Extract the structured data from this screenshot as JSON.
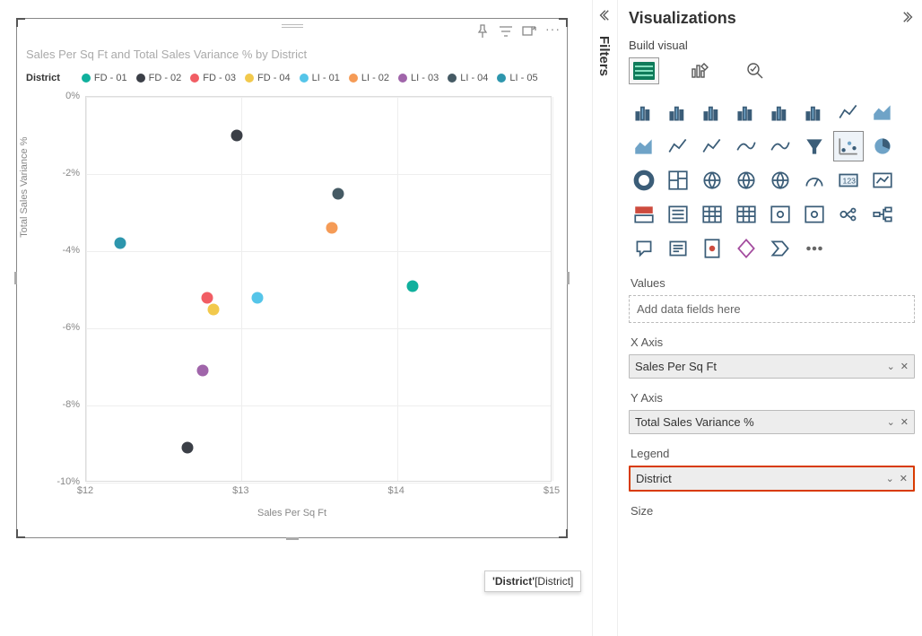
{
  "chart": {
    "title": "Sales Per Sq Ft and Total Sales Variance % by District",
    "legend_title": "District",
    "xlabel": "Sales Per Sq Ft",
    "ylabel": "Total Sales Variance %",
    "toolbar": {
      "pin": "Pin",
      "filters": "Filters",
      "focus": "Focus mode",
      "more": "More"
    }
  },
  "chart_data": {
    "type": "scatter",
    "xlabel": "Sales Per Sq Ft",
    "ylabel": "Total Sales Variance %",
    "xlim": [
      12,
      15
    ],
    "ylim": [
      -10,
      0
    ],
    "x_ticks": [
      "$12",
      "$13",
      "$14",
      "$15"
    ],
    "y_ticks": [
      "0%",
      "-2%",
      "-4%",
      "-6%",
      "-8%",
      "-10%"
    ],
    "series": [
      {
        "name": "FD - 01",
        "color": "#10b09d",
        "points": [
          {
            "x": 14.1,
            "y": -4.9
          }
        ]
      },
      {
        "name": "FD - 02",
        "color": "#3b3f47",
        "points": [
          {
            "x": 12.97,
            "y": -1.0
          },
          {
            "x": 12.65,
            "y": -9.1
          }
        ]
      },
      {
        "name": "FD - 03",
        "color": "#f15d64",
        "points": [
          {
            "x": 12.78,
            "y": -5.2
          }
        ]
      },
      {
        "name": "FD - 04",
        "color": "#f2c94c",
        "points": [
          {
            "x": 12.82,
            "y": -5.5
          }
        ]
      },
      {
        "name": "LI - 01",
        "color": "#55c5e9",
        "points": [
          {
            "x": 13.1,
            "y": -5.2
          }
        ]
      },
      {
        "name": "LI - 02",
        "color": "#f59b56",
        "points": [
          {
            "x": 13.58,
            "y": -3.4
          }
        ]
      },
      {
        "name": "LI - 03",
        "color": "#a065aa",
        "points": [
          {
            "x": 12.75,
            "y": -7.1
          }
        ]
      },
      {
        "name": "LI - 04",
        "color": "#455a64",
        "points": [
          {
            "x": 13.62,
            "y": -2.5
          }
        ]
      },
      {
        "name": "LI - 05",
        "color": "#2d96ad",
        "points": [
          {
            "x": 12.22,
            "y": -3.8
          }
        ]
      }
    ]
  },
  "filters_label": "Filters",
  "viz": {
    "title": "Visualizations",
    "subtitle": "Build visual",
    "icons": [
      "stacked-bar",
      "clustered-bar",
      "stacked-column",
      "clustered-column",
      "stacked-bar-100",
      "clustered-column-100",
      "line",
      "area",
      "stacked-area",
      "line-clustered",
      "line-stacked",
      "ribbon",
      "waterfall",
      "funnel",
      "scatter",
      "pie",
      "donut",
      "treemap",
      "map",
      "filled-map",
      "azure-map",
      "gauge",
      "card",
      "kpi",
      "multi-row",
      "slicer",
      "table",
      "matrix",
      "r-visual",
      "python-visual",
      "key-influencers",
      "decomposition-tree",
      "qna",
      "narrative",
      "paginated",
      "powerapps",
      "powerautomate",
      "more"
    ],
    "values_label": "Values",
    "values_placeholder": "Add data fields here",
    "xaxis_label": "X Axis",
    "xaxis_field": "Sales Per Sq Ft",
    "yaxis_label": "Y Axis",
    "yaxis_field": "Total Sales Variance %",
    "legend_label": "Legend",
    "legend_field": "District",
    "size_label": "Size"
  },
  "drag_tooltip": {
    "prefix": "'District'",
    "suffix": "[District]"
  }
}
